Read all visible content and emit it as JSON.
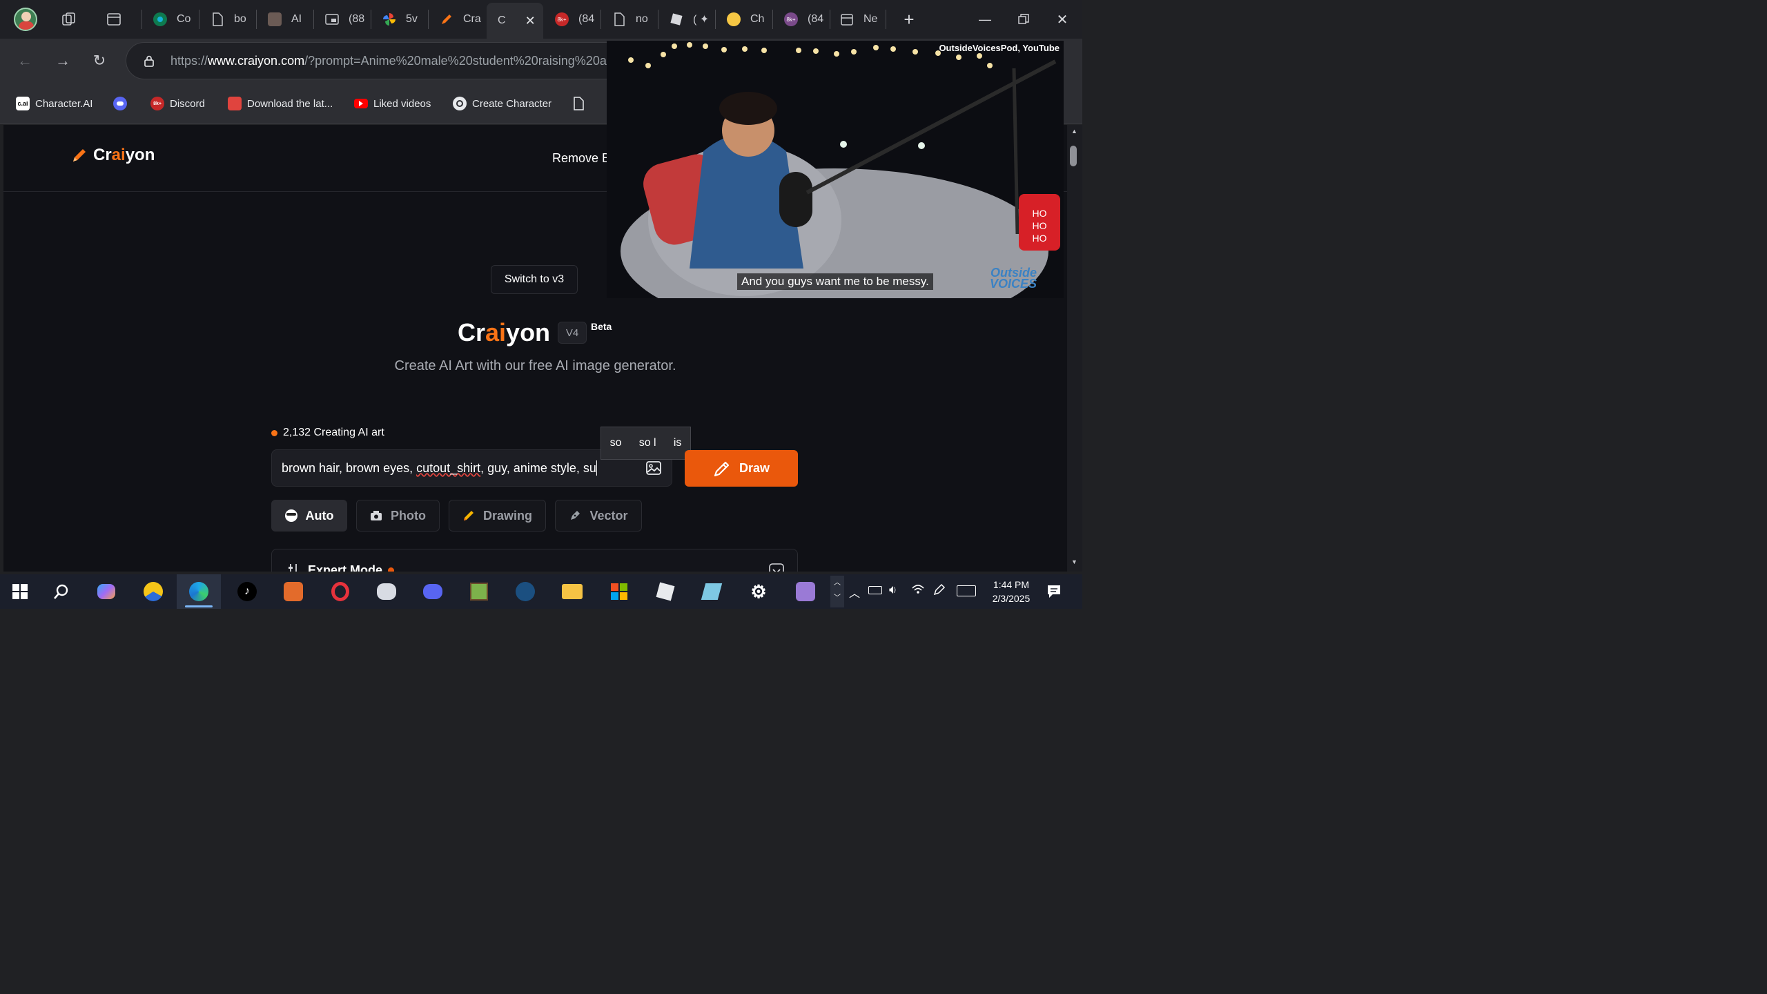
{
  "browser": {
    "tabs": [
      {
        "label": "Co",
        "icon": "copilot-icon"
      },
      {
        "label": "bo",
        "icon": "document-icon"
      },
      {
        "label": "AI",
        "icon": "character-icon"
      },
      {
        "label": "(88",
        "icon": "picture-in-picture-icon"
      },
      {
        "label": "5v",
        "icon": "pinwheel-icon"
      },
      {
        "label": "Cra",
        "icon": "craiyon-pencil-icon"
      },
      {
        "label": "C",
        "icon": "close-icon",
        "active": true
      },
      {
        "label": "(84",
        "icon": "8k-icon"
      },
      {
        "label": "no",
        "icon": "document-icon"
      },
      {
        "label": "( ✦",
        "icon": "roblox-icon"
      },
      {
        "label": "Ch",
        "icon": "emoji-icon"
      },
      {
        "label": "(84",
        "icon": "8k-icon"
      },
      {
        "label": "Ne",
        "icon": "calendar-icon"
      }
    ],
    "url_prefix": "https://",
    "url_host": "www.craiyon.com",
    "url_rest": "/?prompt=Anime%20male%20student%20raising%20a%20",
    "bookmarks": [
      {
        "label": "Character.AI",
        "icon": "c.ai"
      },
      {
        "label": "",
        "icon": "discord-icon"
      },
      {
        "label": "Discord",
        "icon": "8k+"
      },
      {
        "label": "Download the lat...",
        "icon": "store-icon"
      },
      {
        "label": "Liked videos",
        "icon": "youtube-icon"
      },
      {
        "label": "Create Character",
        "icon": "openai-icon"
      },
      {
        "label": "",
        "icon": "document-icon"
      }
    ]
  },
  "site": {
    "logo_pre": "Cr",
    "logo_ai": "ai",
    "logo_post": "yon",
    "nav_item": "Remove B",
    "switch_button": "Switch to v3",
    "hero_pre": "Cr",
    "hero_ai": "ai",
    "hero_post": "yon",
    "version": "V4",
    "beta": "Beta",
    "subtitle": "Create AI Art with our free AI image generator.",
    "status": "2,132 Creating AI art",
    "prompt_before": "brown hair, brown eyes, ",
    "prompt_misspelled": "cutout_shirt",
    "prompt_after": ", guy, anime style, su",
    "draw_button": "Draw",
    "autocomplete": [
      "so",
      "so l",
      "is"
    ],
    "modes": [
      {
        "label": "Auto",
        "icon": "auto-face-icon",
        "active": true
      },
      {
        "label": "Photo",
        "icon": "camera-icon",
        "active": false
      },
      {
        "label": "Drawing",
        "icon": "pencil-icon",
        "active": false
      },
      {
        "label": "Vector",
        "icon": "pen-nib-icon",
        "active": false
      }
    ],
    "expert_mode": "Expert Mode"
  },
  "pip": {
    "channel": "OutsideVoicesPod, YouTube",
    "caption": "And you guys want me to be messy.",
    "logo_line1": "Outside",
    "logo_line2": "VOICES",
    "mug_text": "HO HO HO"
  },
  "taskbar": {
    "time": "1:44 PM",
    "date": "2/3/2025"
  },
  "colors": {
    "accent": "#f97316",
    "draw_button": "#ea580c",
    "page_bg": "#101116",
    "browser_bg": "#2d2e33"
  }
}
